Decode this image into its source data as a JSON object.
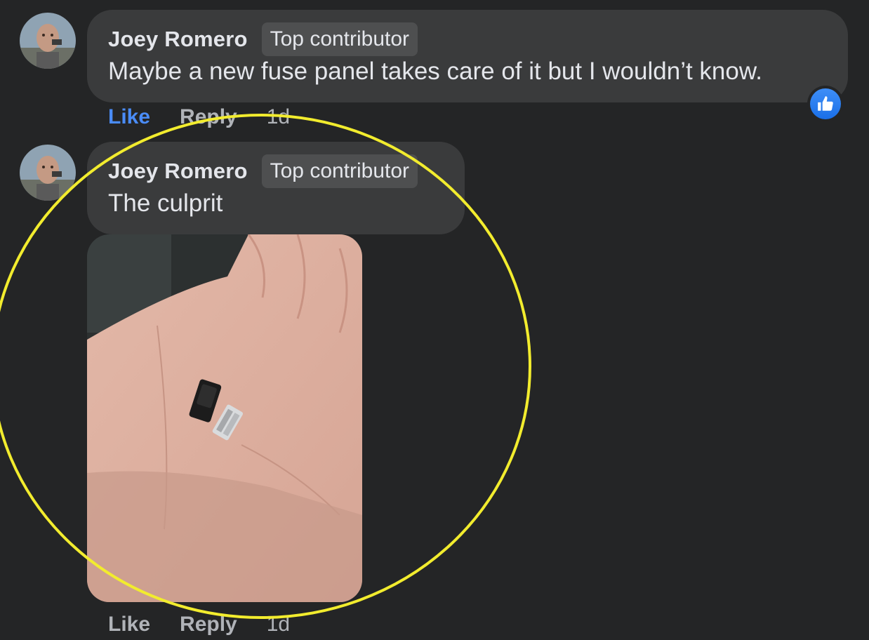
{
  "comments": [
    {
      "author": "Joey Romero",
      "badge": "Top contributor",
      "text": "Maybe a new fuse panel takes care of it but I wouldn’t know.",
      "actions": {
        "like": "Like",
        "reply": "Reply",
        "time": "1d"
      },
      "liked": true,
      "reaction": "like-reaction-icon"
    },
    {
      "author": "Joey Romero",
      "badge": "Top contributor",
      "text": "The culprit",
      "actions": {
        "like": "Like",
        "reply": "Reply",
        "time": "1d"
      },
      "liked": false,
      "has_photo": true
    }
  ],
  "colors": {
    "background": "#242526",
    "bubble": "#3a3b3c",
    "badge": "#4e4f50",
    "text": "#e4e6eb",
    "muted": "#b0b3b8",
    "like_active": "#4a8cf7",
    "annotation": "#f2ec2e"
  }
}
